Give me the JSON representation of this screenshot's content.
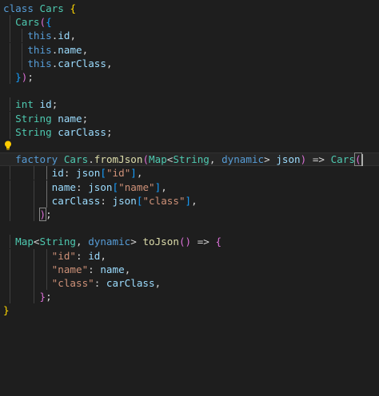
{
  "editor": {
    "lines": [
      [
        {
          "t": "class",
          "c": "kw"
        },
        {
          "t": " "
        },
        {
          "t": "Cars",
          "c": "ty"
        },
        {
          "t": " "
        },
        {
          "t": "{",
          "c": "br1"
        }
      ],
      [
        {
          "t": "  "
        },
        {
          "t": "Cars",
          "c": "ty"
        },
        {
          "t": "(",
          "c": "br2"
        },
        {
          "t": "{",
          "c": "br3"
        }
      ],
      [
        {
          "t": "    "
        },
        {
          "t": "this",
          "c": "kw"
        },
        {
          "t": "."
        },
        {
          "t": "id",
          "c": "var"
        },
        {
          "t": ","
        }
      ],
      [
        {
          "t": "    "
        },
        {
          "t": "this",
          "c": "kw"
        },
        {
          "t": "."
        },
        {
          "t": "name",
          "c": "var"
        },
        {
          "t": ","
        }
      ],
      [
        {
          "t": "    "
        },
        {
          "t": "this",
          "c": "kw"
        },
        {
          "t": "."
        },
        {
          "t": "carClass",
          "c": "var"
        },
        {
          "t": ","
        }
      ],
      [
        {
          "t": "  "
        },
        {
          "t": "}",
          "c": "br3"
        },
        {
          "t": ")",
          "c": "br2"
        },
        {
          "t": ";"
        }
      ],
      [],
      [
        {
          "t": "  "
        },
        {
          "t": "int",
          "c": "ty"
        },
        {
          "t": " "
        },
        {
          "t": "id",
          "c": "var"
        },
        {
          "t": ";"
        }
      ],
      [
        {
          "t": "  "
        },
        {
          "t": "String",
          "c": "ty"
        },
        {
          "t": " "
        },
        {
          "t": "name",
          "c": "var"
        },
        {
          "t": ";"
        }
      ],
      [
        {
          "t": "  "
        },
        {
          "t": "String",
          "c": "ty"
        },
        {
          "t": " "
        },
        {
          "t": "carClass",
          "c": "var"
        },
        {
          "t": ";"
        }
      ],
      [],
      [
        {
          "t": "  "
        },
        {
          "t": "factory",
          "c": "kw"
        },
        {
          "t": " "
        },
        {
          "t": "Cars",
          "c": "ty"
        },
        {
          "t": "."
        },
        {
          "t": "fromJson",
          "c": "fn"
        },
        {
          "t": "(",
          "c": "br2"
        },
        {
          "t": "Map",
          "c": "ty"
        },
        {
          "t": "<"
        },
        {
          "t": "String",
          "c": "ty"
        },
        {
          "t": ", "
        },
        {
          "t": "dynamic",
          "c": "kw"
        },
        {
          "t": "> "
        },
        {
          "t": "json",
          "c": "var"
        },
        {
          "t": "",
          "c": "br2"
        },
        {
          "t": ")",
          "c": "br2"
        },
        {
          "t": " => "
        },
        {
          "t": "Cars",
          "c": "ty"
        },
        {
          "t": "(",
          "c": "br2",
          "box": true
        }
      ],
      [
        {
          "t": "        "
        },
        {
          "t": "id",
          "c": "var"
        },
        {
          "t": ": "
        },
        {
          "t": "json",
          "c": "var"
        },
        {
          "t": "[",
          "c": "br3"
        },
        {
          "t": "\"id\"",
          "c": "str"
        },
        {
          "t": "]",
          "c": "br3"
        },
        {
          "t": ","
        }
      ],
      [
        {
          "t": "        "
        },
        {
          "t": "name",
          "c": "var"
        },
        {
          "t": ": "
        },
        {
          "t": "json",
          "c": "var"
        },
        {
          "t": "[",
          "c": "br3"
        },
        {
          "t": "\"name\"",
          "c": "str"
        },
        {
          "t": "]",
          "c": "br3"
        },
        {
          "t": ","
        }
      ],
      [
        {
          "t": "        "
        },
        {
          "t": "carClass",
          "c": "var"
        },
        {
          "t": ": "
        },
        {
          "t": "json",
          "c": "var"
        },
        {
          "t": "[",
          "c": "br3"
        },
        {
          "t": "\"class\"",
          "c": "str"
        },
        {
          "t": "]",
          "c": "br3"
        },
        {
          "t": ","
        }
      ],
      [
        {
          "t": "      "
        },
        {
          "t": ")",
          "c": "br2",
          "box": true
        },
        {
          "t": ";"
        }
      ],
      [],
      [
        {
          "t": "  "
        },
        {
          "t": "Map",
          "c": "ty"
        },
        {
          "t": "<"
        },
        {
          "t": "String",
          "c": "ty"
        },
        {
          "t": ", "
        },
        {
          "t": "dynamic",
          "c": "kw"
        },
        {
          "t": "> "
        },
        {
          "t": "toJson",
          "c": "fn"
        },
        {
          "t": "(",
          "c": "br2"
        },
        {
          "t": ")",
          "c": "br2"
        },
        {
          "t": " => "
        },
        {
          "t": "{",
          "c": "br2"
        }
      ],
      [
        {
          "t": "        "
        },
        {
          "t": "\"id\"",
          "c": "str"
        },
        {
          "t": ": "
        },
        {
          "t": "id",
          "c": "var"
        },
        {
          "t": ","
        }
      ],
      [
        {
          "t": "        "
        },
        {
          "t": "\"name\"",
          "c": "str"
        },
        {
          "t": ": "
        },
        {
          "t": "name",
          "c": "var"
        },
        {
          "t": ","
        }
      ],
      [
        {
          "t": "        "
        },
        {
          "t": "\"class\"",
          "c": "str"
        },
        {
          "t": ": "
        },
        {
          "t": "carClass",
          "c": "var"
        },
        {
          "t": ","
        }
      ],
      [
        {
          "t": "      "
        },
        {
          "t": "}",
          "c": "br2"
        },
        {
          "t": ";"
        }
      ],
      [
        {
          "t": "}",
          "c": "br1"
        }
      ]
    ],
    "current_line": 11,
    "lightbulb_icon": "lightbulb-icon"
  }
}
